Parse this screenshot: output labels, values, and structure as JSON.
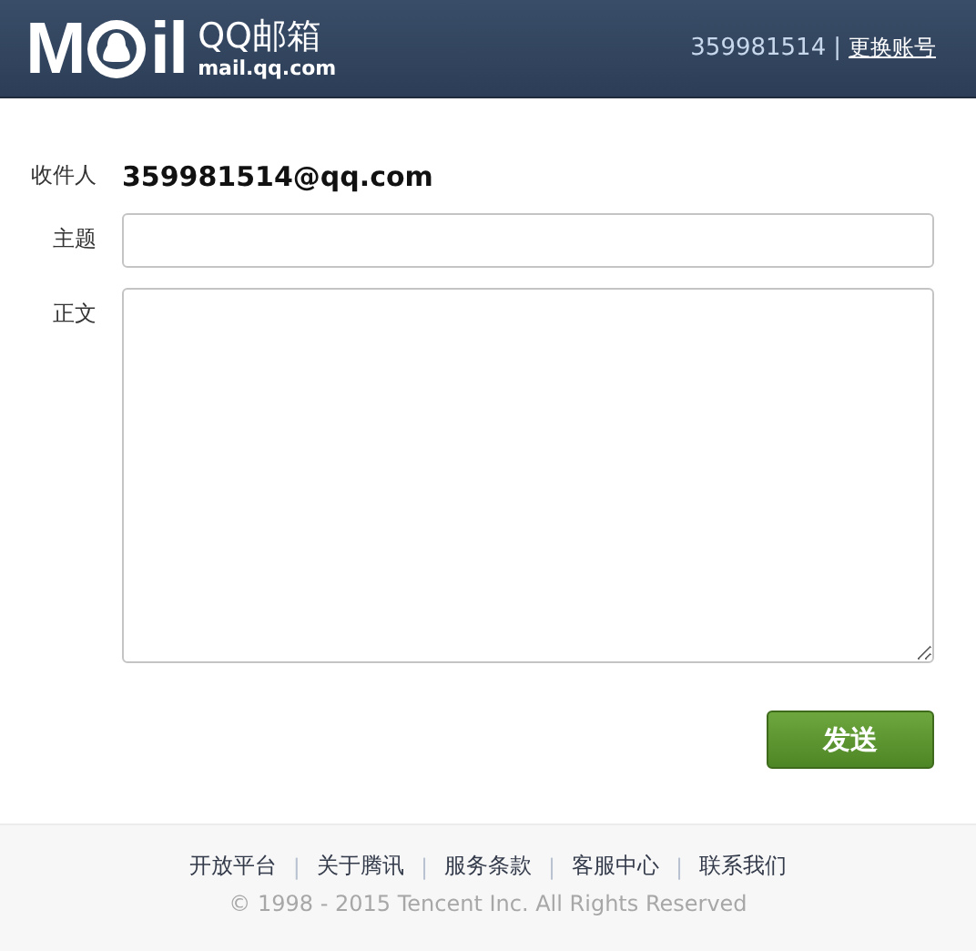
{
  "header": {
    "logo": {
      "left": "M",
      "right": "il",
      "name": "QQ邮箱",
      "domain": "mail.qq.com"
    },
    "account": "359981514",
    "separator": "|",
    "switch_link": "更换账号"
  },
  "form": {
    "recipient": {
      "label": "收件人",
      "value": "359981514@qq.com"
    },
    "subject": {
      "label": "主题"
    },
    "body": {
      "label": "正文"
    },
    "send_button": "发送"
  },
  "footer": {
    "separator": "|",
    "links": [
      "开放平台",
      "关于腾讯",
      "服务条款",
      "客服中心",
      "联系我们"
    ],
    "copyright": "© 1998 - 2015 Tencent Inc. All Rights Reserved"
  }
}
